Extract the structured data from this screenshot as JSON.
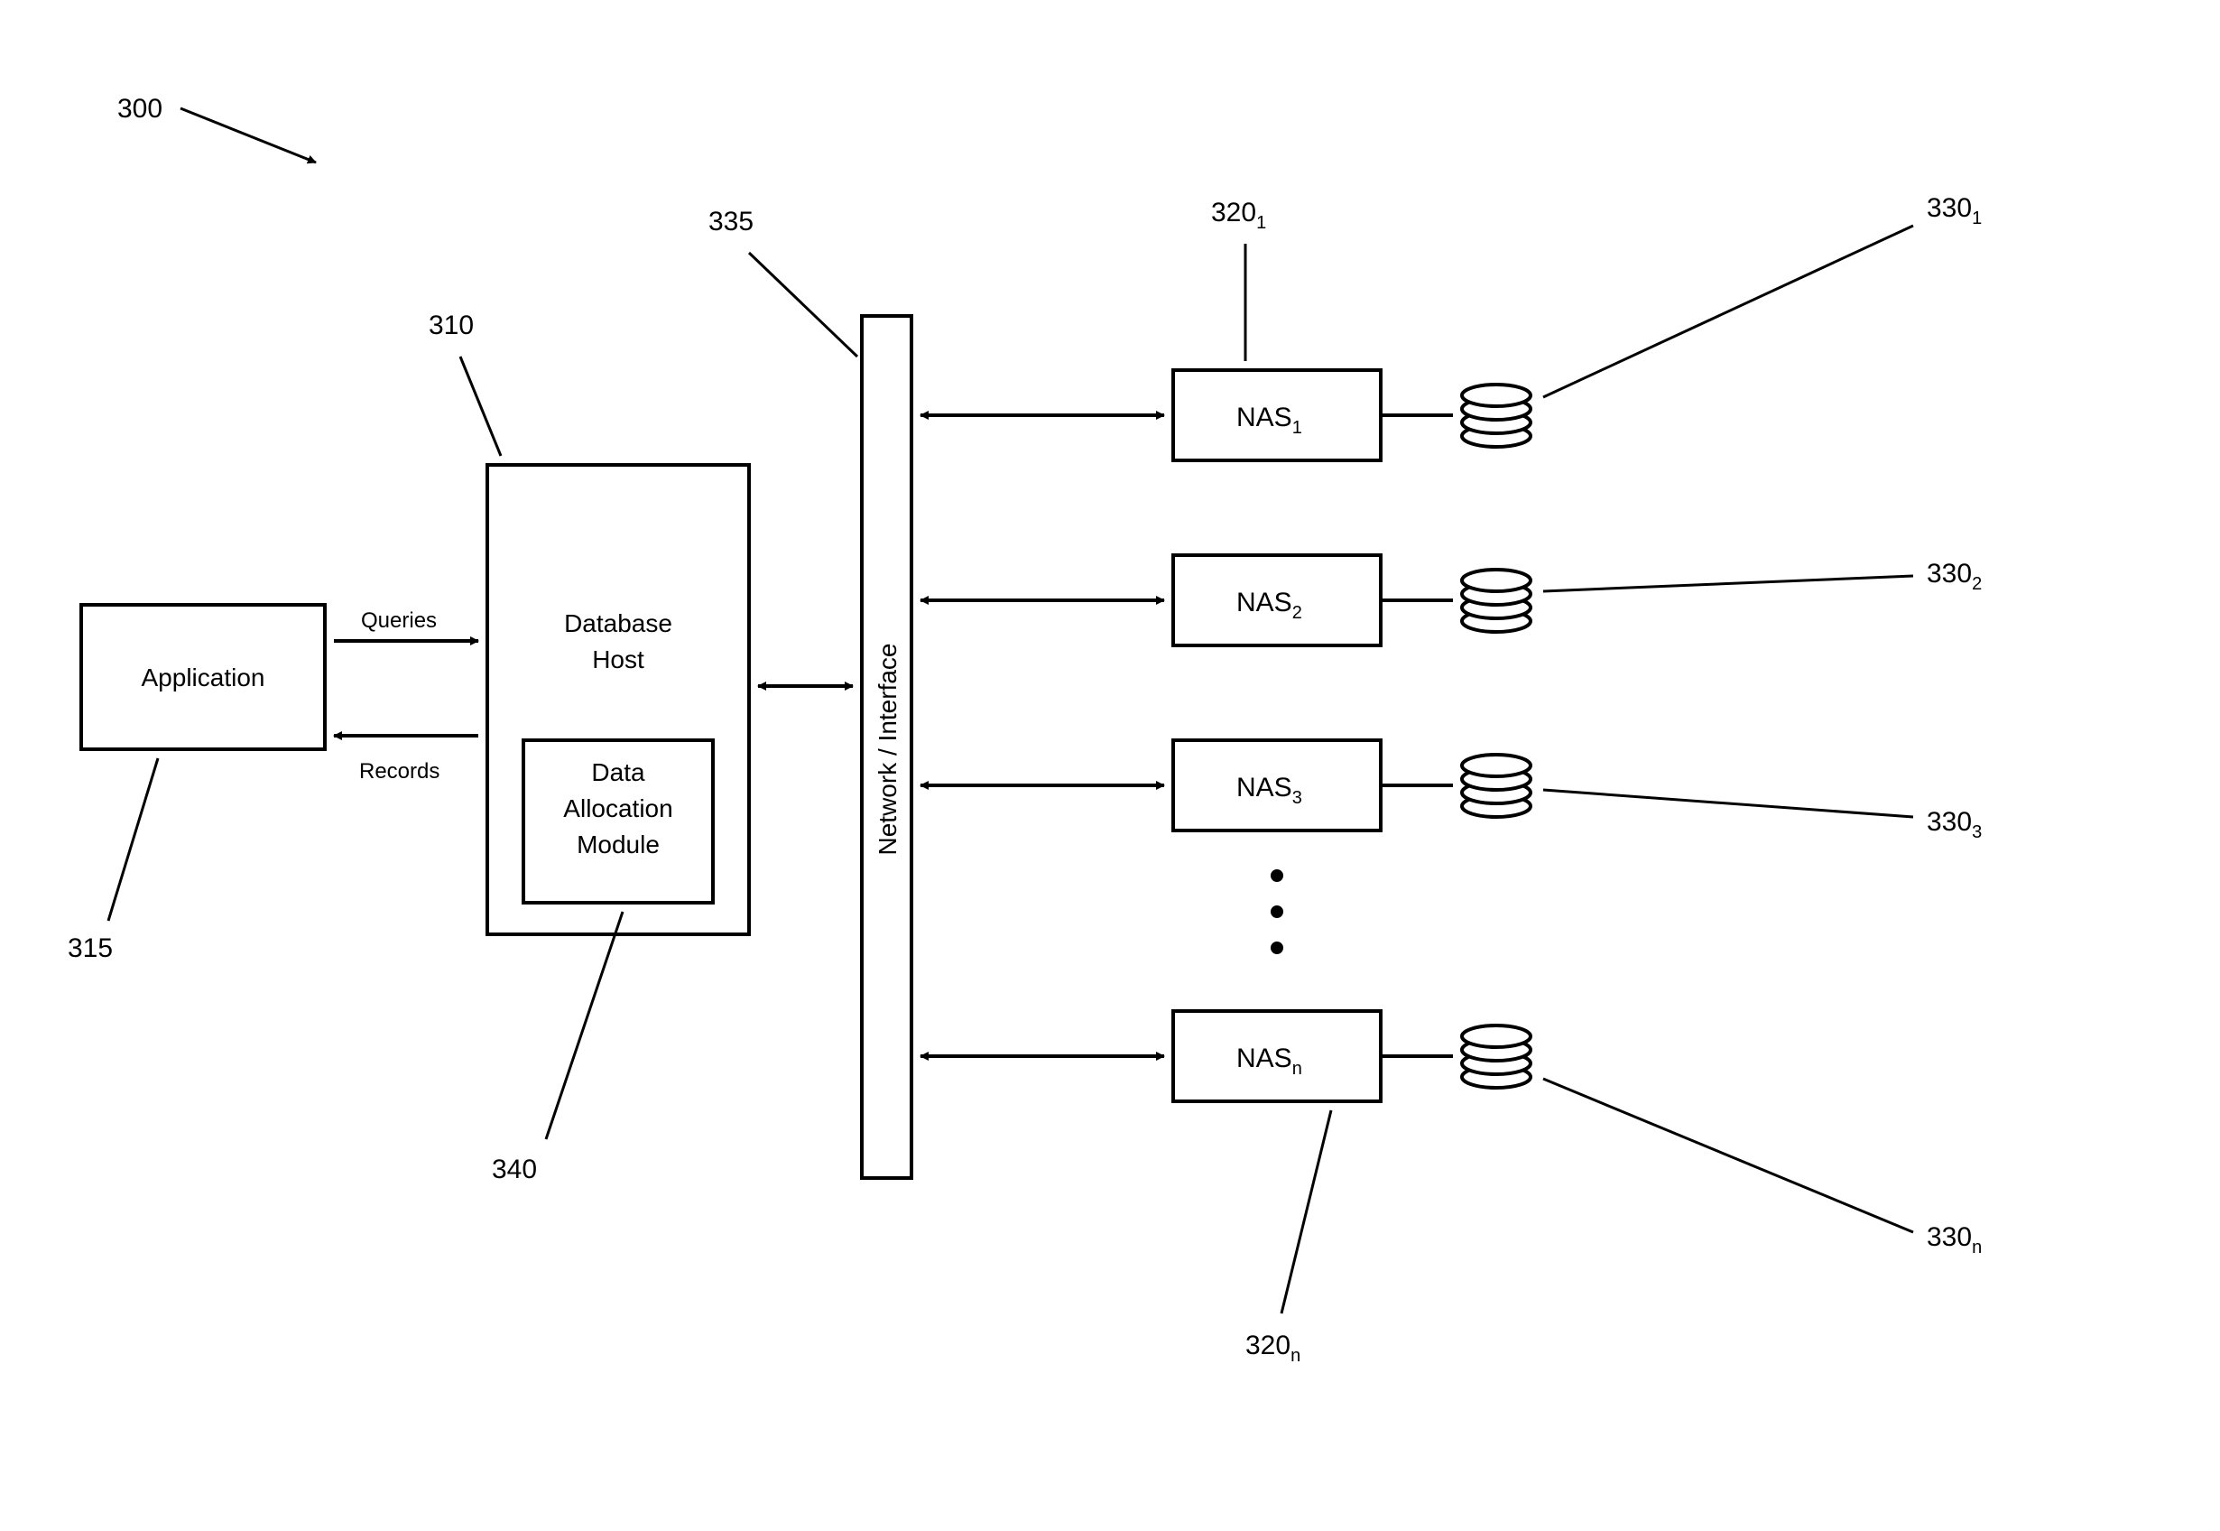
{
  "refs": {
    "r300": "300",
    "r310": "310",
    "r315": "315",
    "r335": "335",
    "r340": "340",
    "r320_1": "320",
    "r320_n": "320",
    "r330_1": "330",
    "r330_2": "330",
    "r330_3": "330",
    "r330_n": "330"
  },
  "subs": {
    "sub1": "1",
    "sub2": "2",
    "sub3": "3",
    "subn": "n"
  },
  "blocks": {
    "application": "Application",
    "dbhost_l1": "Database",
    "dbhost_l2": "Host",
    "dam_l1": "Data",
    "dam_l2": "Allocation",
    "dam_l3": "Module",
    "network": "Network / Interface"
  },
  "edges": {
    "queries": "Queries",
    "records": "Records"
  },
  "nas": {
    "prefix": "NAS"
  }
}
